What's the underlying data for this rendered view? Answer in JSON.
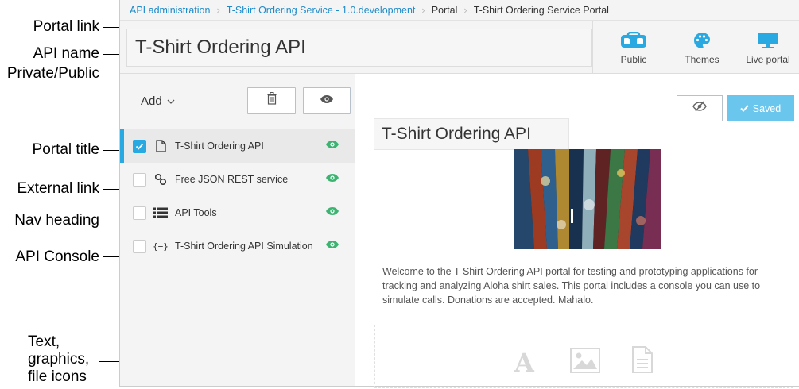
{
  "annotations": {
    "portal_link": "Portal link",
    "api_name": "API name",
    "private_public": "Private/Public",
    "portal_title": "Portal title",
    "external_link": "External link",
    "nav_heading": "Nav heading",
    "api_console": "API Console",
    "text_graphics_line1": "Text,",
    "text_graphics_line2": "graphics,",
    "text_graphics_line3": "file icons"
  },
  "breadcrumb": [
    {
      "label": "API administration"
    },
    {
      "label": "T-Shirt Ordering Service - 1.0.development"
    },
    {
      "label": "Portal"
    },
    {
      "label": "T-Shirt Ordering Service Portal"
    }
  ],
  "header": {
    "api_name": "T-Shirt Ordering API",
    "public_label": "Public",
    "themes_label": "Themes",
    "live_portal_label": "Live portal"
  },
  "sidebar": {
    "add_label": "Add",
    "items": [
      {
        "label": "T-Shirt Ordering API",
        "icon": "page-icon",
        "checked": true
      },
      {
        "label": "Free JSON REST service",
        "icon": "link-icon",
        "checked": false
      },
      {
        "label": "API Tools",
        "icon": "list-icon",
        "checked": false
      },
      {
        "label": "T-Shirt Ordering API Simulation",
        "icon": "console-icon",
        "checked": false
      }
    ]
  },
  "editor": {
    "portal_title": "T-Shirt Ordering API",
    "saved_label": "Saved",
    "welcome_text": "Welcome to the T-Shirt Ordering API portal for testing and prototyping applications for tracking and analyzing Aloha shirt sales. This portal includes a console you can use to simulate calls. Donations are accepted. Mahalo."
  },
  "colors": {
    "accent": "#29a9e1",
    "saved_button": "#6bc6ee",
    "visible_eye": "#3cb371",
    "link": "#1f8ac8"
  }
}
